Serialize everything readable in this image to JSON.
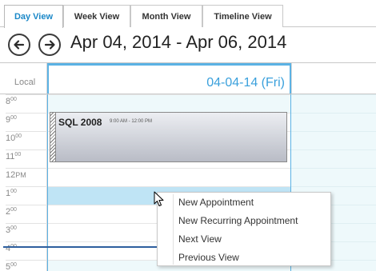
{
  "view_tabs": [
    {
      "label": "Day View"
    },
    {
      "label": "Week View"
    },
    {
      "label": "Month View"
    },
    {
      "label": "Timeline View"
    }
  ],
  "active_tab": "Day View",
  "navigation": {
    "prev_icon": "arrow-left-circle-icon",
    "next_icon": "arrow-right-circle-icon",
    "date_range": "Apr 04, 2014 - Apr 06, 2014"
  },
  "scheduler": {
    "timezone_label": "Local",
    "day_header": "04-04-14 (Fri)",
    "time_slots": [
      {
        "hour": "8",
        "suffix": "00"
      },
      {
        "hour": "9",
        "suffix": "00"
      },
      {
        "hour": "10",
        "suffix": "00"
      },
      {
        "hour": "11",
        "suffix": "00"
      },
      {
        "hour": "12",
        "suffix": "PM"
      },
      {
        "hour": "1",
        "suffix": "00"
      },
      {
        "hour": "2",
        "suffix": "00"
      },
      {
        "hour": "3",
        "suffix": "00"
      },
      {
        "hour": "4",
        "suffix": "00"
      },
      {
        "hour": "5",
        "suffix": "00"
      }
    ]
  },
  "appointment": {
    "title": "SQL 2008",
    "time": "9:00 AM - 12:00 PM"
  },
  "context_menu": {
    "items": [
      {
        "label": "New Appointment"
      },
      {
        "label": "New Recurring Appointment"
      },
      {
        "label": "Next View"
      },
      {
        "label": "Previous View"
      }
    ]
  },
  "colors": {
    "accent": "#3aa0dc",
    "selected_slot": "#bfe4f5",
    "off_hours": "#eef9fb",
    "now_line": "#2e5f9e"
  }
}
